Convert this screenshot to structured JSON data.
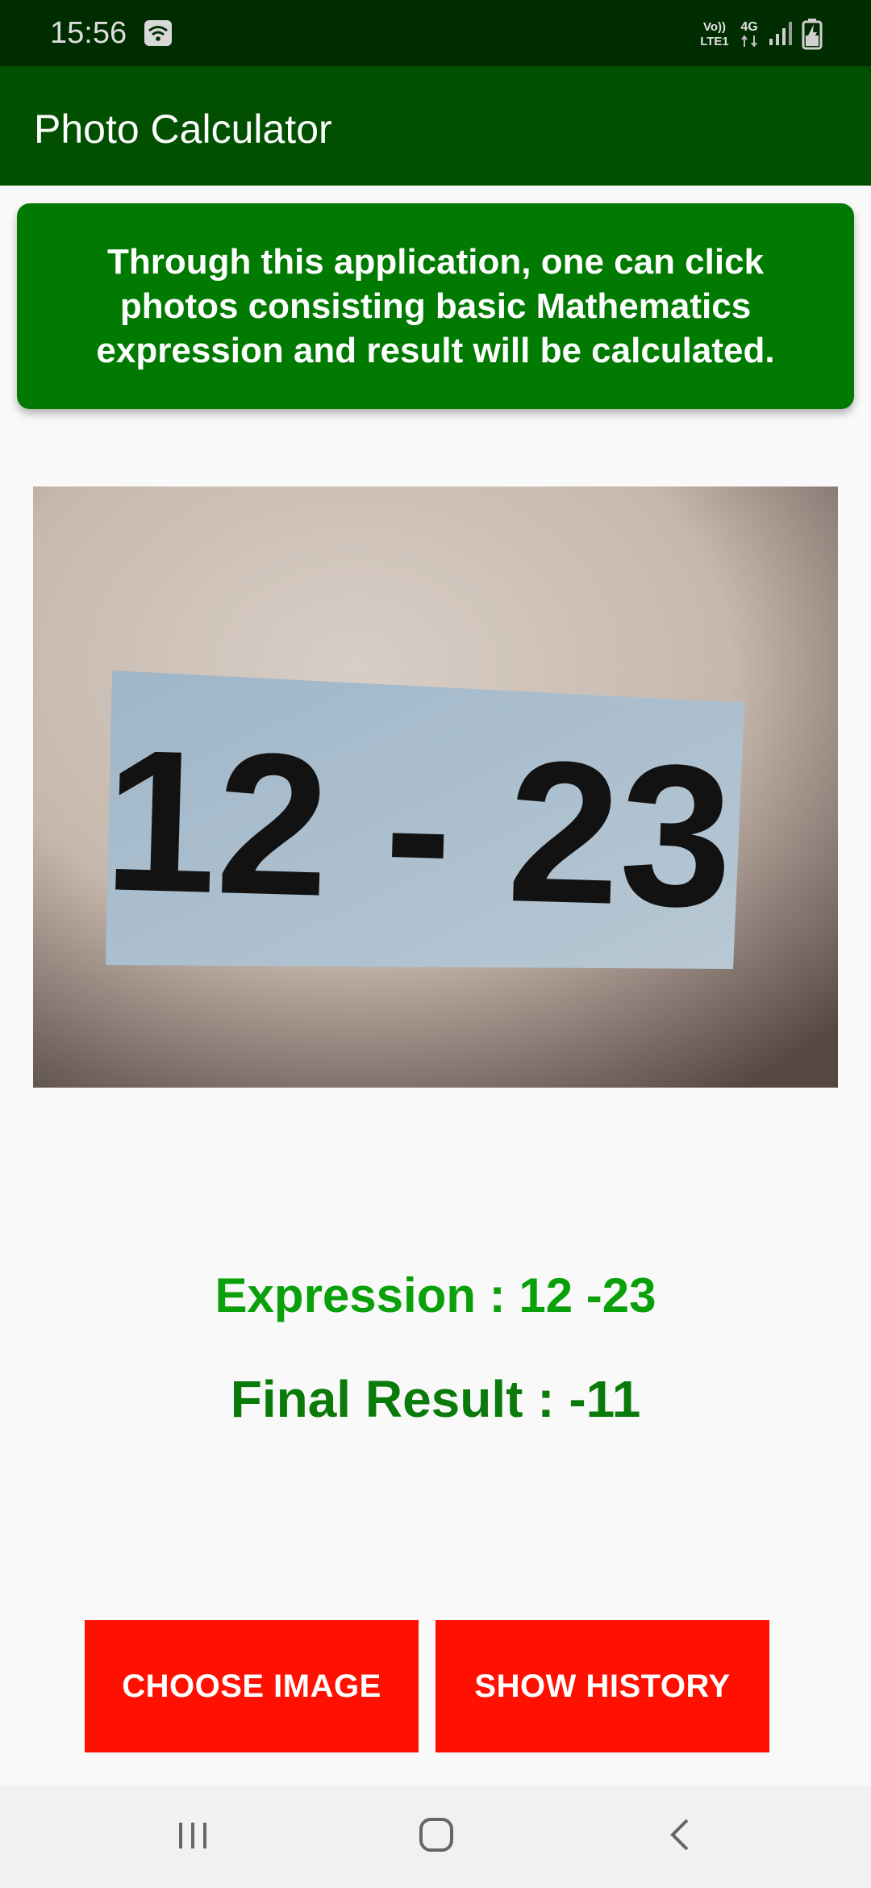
{
  "status_bar": {
    "time": "15:56",
    "icons": [
      "wifi-icon",
      "volte-lte1-icon",
      "4g-icon",
      "signal-icon",
      "battery-charging-icon"
    ],
    "volte_line1": "Vo))",
    "volte_line2": "LTE1",
    "network_label": "4G"
  },
  "app_bar": {
    "title": "Photo Calculator"
  },
  "info_card": {
    "text": "Through this application, one can click photos consisting basic Mathematics expression and result will be calculated."
  },
  "photo": {
    "label": "12 - 23"
  },
  "result": {
    "expression": "Expression : 12 -23",
    "final_result": "Final Result : -11"
  },
  "buttons": {
    "choose_image": "CHOOSE IMAGE",
    "show_history": "SHOW HISTORY"
  },
  "nav_bar": {
    "icons": [
      "recent-apps-icon",
      "home-icon",
      "back-icon"
    ]
  },
  "colors": {
    "status_bar": "#002d00",
    "app_bar": "#005000",
    "info_card": "#007a00",
    "expression_text": "#0aa00a",
    "final_result_text": "#0a7a0a",
    "button": "#ff1000",
    "background": "#f9f9f9"
  }
}
